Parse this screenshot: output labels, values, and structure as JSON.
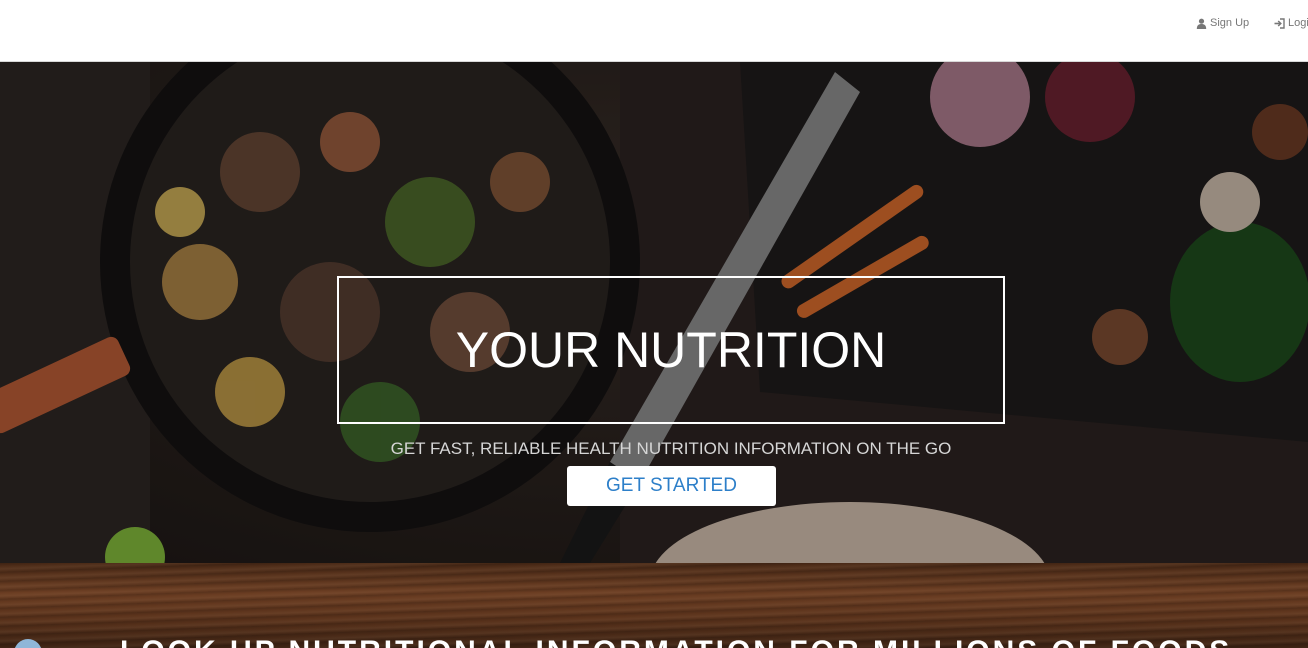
{
  "navbar": {
    "signup_label": "Sign Up",
    "signup_icon": "user-icon",
    "login_label": "Login",
    "login_icon": "log-in-icon"
  },
  "hero": {
    "title": "YOUR NUTRITION",
    "subtitle": "GET FAST, RELIABLE HEALTH NUTRITION INFORMATION ON THE GO",
    "button_label": "GET STARTED"
  },
  "section": {
    "heading": "LOOK UP NUTRITIONAL INFORMATION FOR MILLIONS OF FOODS"
  },
  "colors": {
    "accent": "#2d7fc9",
    "nav_text": "#777777",
    "hero_text": "#ffffff"
  }
}
